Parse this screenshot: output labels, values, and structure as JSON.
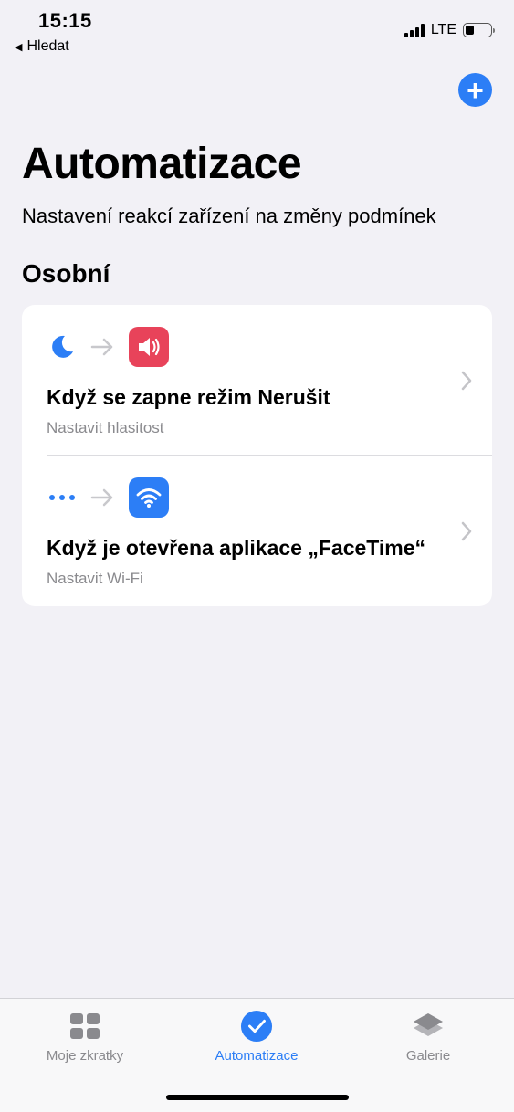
{
  "status": {
    "time": "15:15",
    "back_label": "Hledat",
    "network": "LTE",
    "battery_level": 0.35
  },
  "header": {
    "add_icon": "plus-circle-icon",
    "title": "Automatizace",
    "subtitle": "Nastavení reakcí zařízení na změny podmínek"
  },
  "section": {
    "title": "Osobní"
  },
  "automations": [
    {
      "trigger_icon": "moon-icon",
      "action_icon": "speaker-volume-icon",
      "action_color": "#e8435a",
      "title": "Když se zapne režim Nerušit",
      "subtitle": "Nastavit hlasitost"
    },
    {
      "trigger_icon": "ellipsis-icon",
      "action_icon": "wifi-icon",
      "action_color": "#2c7ef6",
      "title": "Když je otevřena aplikace „FaceTime“",
      "subtitle": "Nastavit Wi-Fi"
    }
  ],
  "tabs": [
    {
      "label": "Moje zkratky",
      "icon": "grid-icon",
      "active": false
    },
    {
      "label": "Automatizace",
      "icon": "checkmark-circle-icon",
      "active": true
    },
    {
      "label": "Galerie",
      "icon": "layers-icon",
      "active": false
    }
  ],
  "colors": {
    "accent": "#2c7ef6",
    "background": "#f2f1f6"
  }
}
